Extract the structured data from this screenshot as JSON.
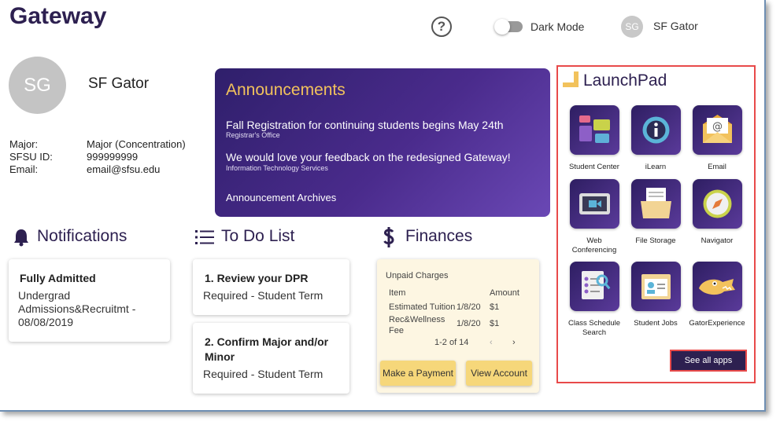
{
  "header": {
    "title": "Gateway",
    "help": "?",
    "dark_mode_label": "Dark Mode",
    "avatar_initials": "SG",
    "user_name": "SF Gator"
  },
  "profile": {
    "initials": "SG",
    "name": "SF Gator",
    "major_label": "Major:",
    "major_value": "Major (Concentration)",
    "id_label": "SFSU ID:",
    "id_value": "999999999",
    "email_label": "Email:",
    "email_value": "email@sfsu.edu"
  },
  "announcements": {
    "title": "Announcements",
    "items": [
      {
        "text": "Fall Registration for continuing students begins May 24th",
        "source": "Registrar's Office"
      },
      {
        "text": "We would love your feedback on the redesigned Gateway!",
        "source": "Information Technology Services"
      }
    ],
    "archive_label": "Announcement Archives"
  },
  "notifications": {
    "title": "Notifications",
    "card": {
      "title": "Fully Admitted",
      "line1": "Undergrad",
      "line2": "Admissions&Recruitmt -",
      "line3": "08/08/2019"
    }
  },
  "todo": {
    "title": "To Do List",
    "items": [
      {
        "title": "1. Review your DPR",
        "sub": "Required - Student Term"
      },
      {
        "title_l1": "2. Confirm Major and/or",
        "title_l2": "Minor",
        "sub": "Required - Student Term"
      }
    ]
  },
  "finances": {
    "title": "Finances",
    "card_title": "Unpaid Charges",
    "col_item": "Item",
    "col_amount": "Amount",
    "rows": [
      {
        "item": "Estimated Tuition",
        "date": "1/8/20",
        "amount": "$1"
      },
      {
        "item_l1": "Rec&Wellness",
        "item_l2": "Fee",
        "date": "1/8/20",
        "amount": "$1"
      }
    ],
    "pager": "1-2 of 14",
    "prev": "‹",
    "next": "›",
    "pay_button": "Make a Payment",
    "view_button": "View Account"
  },
  "launchpad": {
    "title": "LaunchPad",
    "apps": [
      {
        "label": "Student Center",
        "icon": "student-center-icon"
      },
      {
        "label": "iLearn",
        "icon": "ilearn-icon"
      },
      {
        "label": "Email",
        "icon": "email-icon"
      },
      {
        "label_l1": "Web",
        "label_l2": "Conferencing",
        "icon": "video-conference-icon"
      },
      {
        "label": "File Storage",
        "icon": "folder-icon"
      },
      {
        "label": "Navigator",
        "icon": "compass-icon"
      },
      {
        "label_l1": "Class Schedule",
        "label_l2": "Search",
        "icon": "schedule-search-icon"
      },
      {
        "label": "Student Jobs",
        "icon": "id-card-icon"
      },
      {
        "label": "GatorExperience",
        "icon": "gator-icon"
      }
    ],
    "see_all": "See all apps"
  },
  "colors": {
    "brand_purple": "#2d2050",
    "accent_gold": "#f2c25c",
    "highlight_red": "#e84a4a",
    "button_gold": "#f6d77a"
  }
}
